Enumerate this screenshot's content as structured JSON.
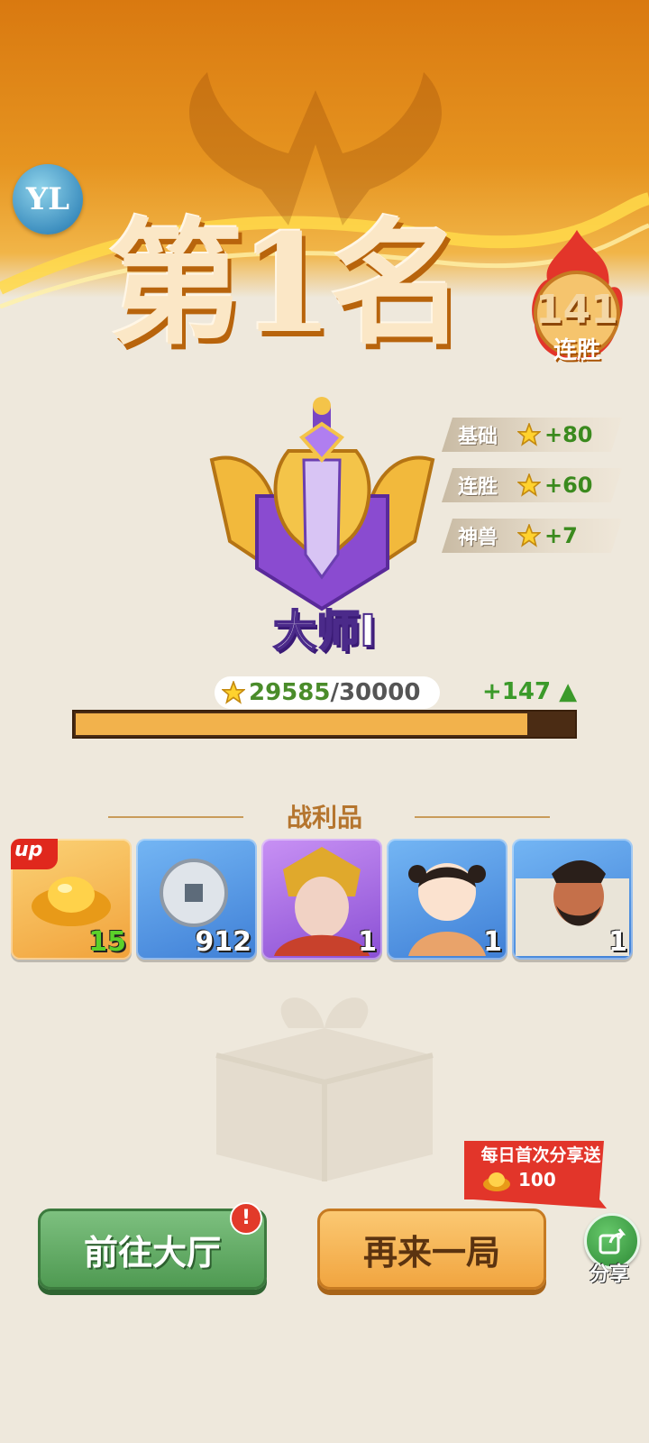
{
  "header": {
    "rank_title": "第1名",
    "win_streak_count": "141",
    "win_streak_label": "连胜",
    "logo_text": "YL"
  },
  "tier": {
    "name": "大师Ⅰ"
  },
  "bonuses": [
    {
      "label": "基础",
      "value": "+80"
    },
    {
      "label": "连胜",
      "value": "+60"
    },
    {
      "label": "神兽",
      "value": "+7"
    }
  ],
  "score": {
    "current": "29585",
    "max": "/30000",
    "gain": "+147",
    "progress_fraction": 0.9862
  },
  "loot": {
    "title": "战利品",
    "items": [
      {
        "name": "gold-ingot",
        "qty": "15",
        "badge": "up",
        "qty_color": "#5ad12a"
      },
      {
        "name": "silver-coin",
        "qty": "912"
      },
      {
        "name": "hero-warrior-portrait",
        "qty": "1"
      },
      {
        "name": "hero-child-portrait",
        "qty": "1"
      },
      {
        "name": "hero-general-portrait",
        "qty": "1"
      }
    ]
  },
  "share_promo": {
    "line1": "每日首次分享送",
    "amount": "100"
  },
  "buttons": {
    "lobby": "前往大厅",
    "again": "再来一局",
    "share": "分享",
    "alert": "!"
  },
  "colors": {
    "top_orange": "#e68a1a",
    "progress_fill": "#f2b24c",
    "progress_track": "#4b2c14",
    "green_accent": "#3b8a1e",
    "lobby_green": "#5aa65d",
    "again_orange": "#f4b04f",
    "tier_purple": "#6b3fb0"
  }
}
